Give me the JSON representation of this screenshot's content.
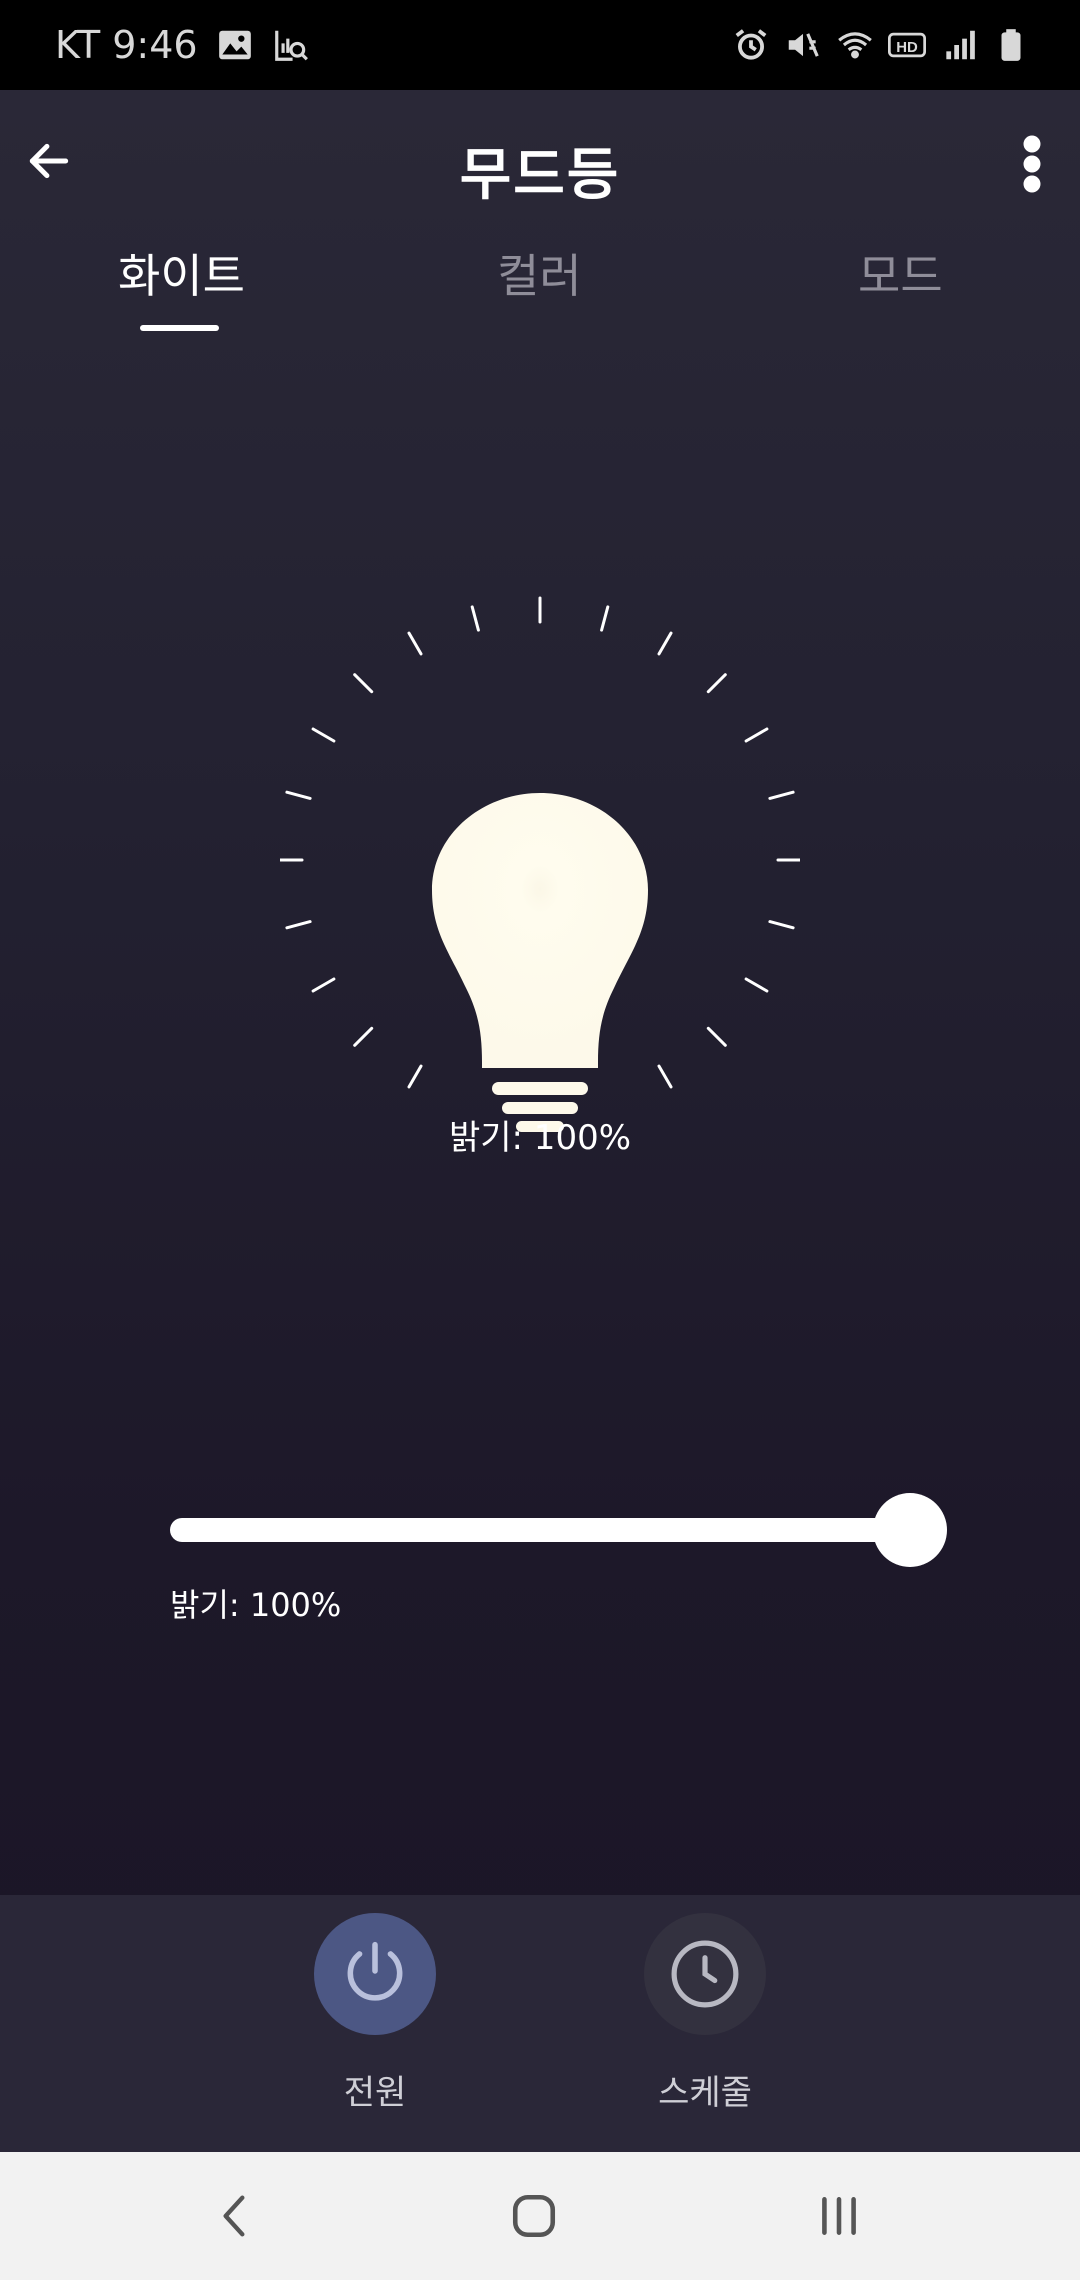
{
  "status_bar": {
    "carrier_time": "KT 9:46",
    "left_icons": [
      "image-icon",
      "analytics-search-icon"
    ],
    "right_icons": [
      "alarm-icon",
      "mute-icon",
      "wifi-icon",
      "hd-icon",
      "signal-icon",
      "battery-icon"
    ]
  },
  "header": {
    "title": "무드등",
    "back_icon": "back-arrow-icon",
    "menu_icon": "more-vertical-icon"
  },
  "tabs": [
    {
      "label": "화이트",
      "active": true
    },
    {
      "label": "컬러",
      "active": false
    },
    {
      "label": "모드",
      "active": false
    }
  ],
  "bulb": {
    "brightness_text": "밝기: 100%",
    "brightness_percent": 100,
    "color": "#fdf9ea"
  },
  "slider": {
    "value_percent": 100,
    "caption": "밝기: 100%"
  },
  "actions": [
    {
      "label": "전원",
      "icon": "power-icon",
      "color": "#4c5784"
    },
    {
      "label": "스케줄",
      "icon": "clock-icon",
      "color": "#33313f"
    }
  ],
  "nav_bar": {
    "icons": [
      "back-chevron-icon",
      "home-icon",
      "recents-icon"
    ]
  }
}
